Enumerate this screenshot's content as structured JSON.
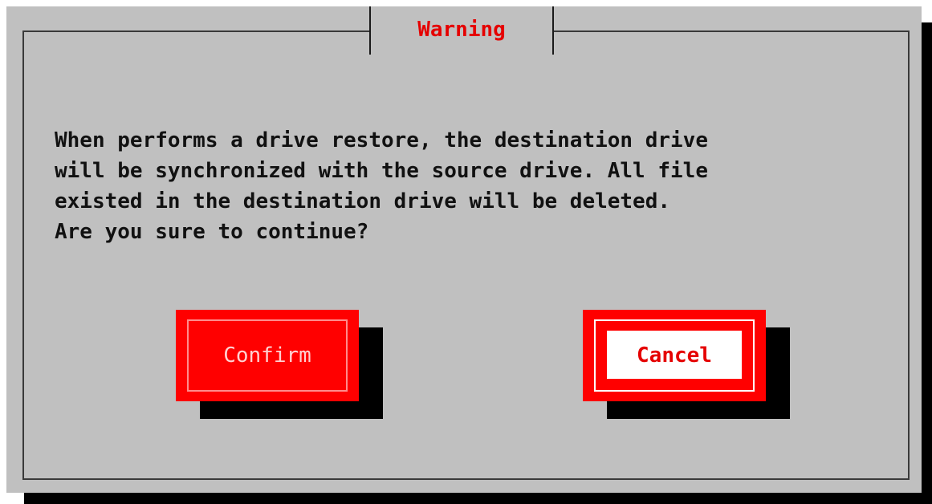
{
  "dialog": {
    "title": "Warning",
    "message": "When performs a drive restore, the destination drive\nwill be synchronized with the source drive. All file\nexisted in the destination drive will be deleted.\nAre you sure to continue?"
  },
  "buttons": {
    "confirm_label": "Confirm",
    "cancel_label": "Cancel",
    "focused": "Cancel"
  },
  "colors": {
    "background": "#c0c0c0",
    "accent": "#ff0000",
    "title": "#e50000",
    "text": "#111111",
    "shadow": "#000000"
  }
}
